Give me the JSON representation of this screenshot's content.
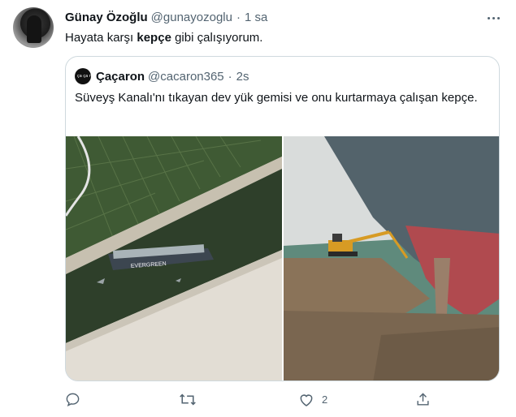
{
  "tweet": {
    "display_name": "Günay Özoğlu",
    "handle": "@gunayozoglu",
    "separator": "·",
    "time": "1 sa",
    "text_before": "Hayata karşı ",
    "text_bold": "kepçe",
    "text_after": " gibi çalışıyorum."
  },
  "quote": {
    "avatar_text": "ça ça ron",
    "display_name": "Çaçaron",
    "handle": "@cacaron365",
    "separator": "·",
    "time": "2s",
    "text": "Süveyş Kanalı'nı tıkayan dev yük gemisi ve onu kurtarmaya çalışan kepçe.",
    "ship_label": "EVERGREEN"
  },
  "actions": {
    "reply_count": "",
    "retweet_count": "",
    "like_count": "2",
    "share_count": ""
  },
  "icons": [
    "more-icon",
    "reply-icon",
    "retweet-icon",
    "like-icon",
    "share-icon"
  ],
  "colors": {
    "text": "#0f1419",
    "secondary": "#536471",
    "border": "#cfd9de"
  }
}
